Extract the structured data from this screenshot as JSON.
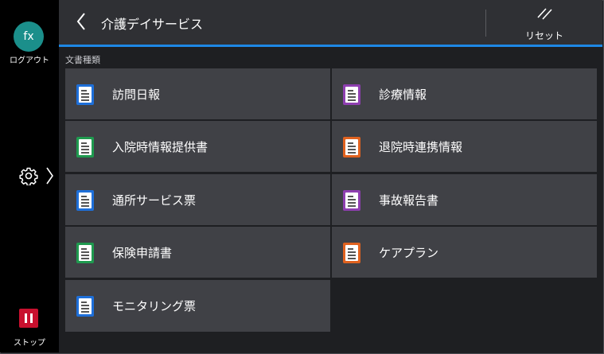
{
  "sidebar": {
    "avatar_text": "fx",
    "logout_label": "ログアウト",
    "stop_label": "ストップ",
    "accent_color": "#1b8f8b",
    "stop_color": "#c8102e"
  },
  "header": {
    "title": "介護デイサービス",
    "reset_label": "リセット",
    "underline_color": "#1e88e5"
  },
  "content": {
    "section_label": "文書種類",
    "tiles": [
      {
        "label": "訪問日報",
        "icon_color": "#1e6fd9",
        "icon": "document-icon"
      },
      {
        "label": "診療情報",
        "icon_color": "#8e3fb0",
        "icon": "document-icon"
      },
      {
        "label": "入院時情報提供書",
        "icon_color": "#1f9a4f",
        "icon": "document-icon"
      },
      {
        "label": "退院時連携情報",
        "icon_color": "#e0621f",
        "icon": "document-icon"
      },
      {
        "label": "通所サービス票",
        "icon_color": "#1e6fd9",
        "icon": "document-icon"
      },
      {
        "label": "事故報告書",
        "icon_color": "#8e3fb0",
        "icon": "document-icon"
      },
      {
        "label": "保険申請書",
        "icon_color": "#1f9a4f",
        "icon": "document-icon"
      },
      {
        "label": "ケアプラン",
        "icon_color": "#e0621f",
        "icon": "document-icon"
      },
      {
        "label": "モニタリング票",
        "icon_color": "#1e6fd9",
        "icon": "document-icon"
      }
    ]
  }
}
